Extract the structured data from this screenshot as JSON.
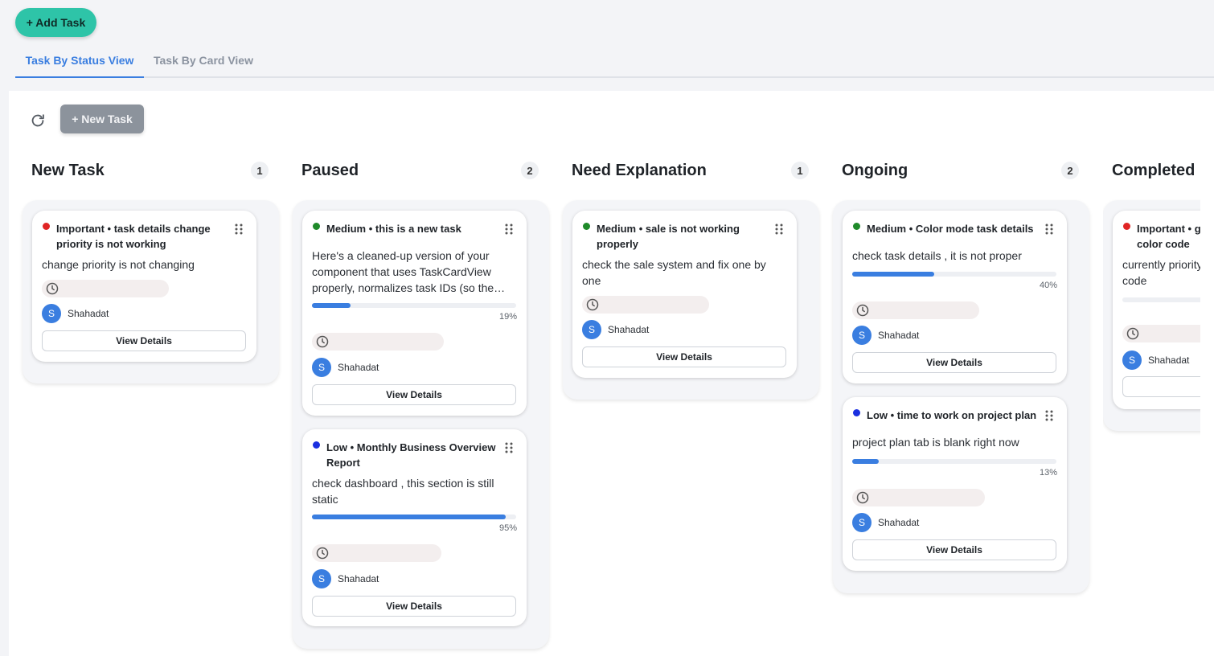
{
  "toolbar": {
    "add_task_label": "+ Add Task"
  },
  "tabs": [
    {
      "label": "Task By Status View",
      "active": true
    },
    {
      "label": "Task By Card View",
      "active": false
    }
  ],
  "panel": {
    "new_task_label": "+ New Task",
    "refresh_icon": "refresh-icon"
  },
  "columns": [
    {
      "title": "New Task",
      "count": "1",
      "cards": [
        {
          "priority": "Important",
          "priority_color": "#e02424",
          "title": "Important • task details change priority is not working",
          "description": "change priority is not changing",
          "assignee": "Shahadat",
          "assignee_initial": "S",
          "details_label": "View Details"
        }
      ]
    },
    {
      "title": "Paused",
      "count": "2",
      "cards": [
        {
          "priority": "Medium",
          "priority_color": "#1f8a2a",
          "title": "Medium • this is a new task",
          "description": "Here's a cleaned-up version of your component that uses TaskCardView properly, normalizes task IDs (so the…",
          "progress": 19,
          "progress_label": "19%",
          "assignee": "Shahadat",
          "assignee_initial": "S",
          "details_label": "View Details"
        },
        {
          "priority": "Low",
          "priority_color": "#1a2fe0",
          "title": "Low • Monthly Business Overview Report",
          "description": "check dashboard , this section is still static",
          "progress": 95,
          "progress_label": "95%",
          "assignee": "Shahadat",
          "assignee_initial": "S",
          "details_label": "View Details"
        }
      ]
    },
    {
      "title": "Need Explanation",
      "count": "1",
      "cards": [
        {
          "priority": "Medium",
          "priority_color": "#1f8a2a",
          "title": "Medium • sale is not working properly",
          "description": "check the sale system and fix one by one",
          "assignee": "Shahadat",
          "assignee_initial": "S",
          "details_label": "View Details"
        }
      ]
    },
    {
      "title": "Ongoing",
      "count": "2",
      "cards": [
        {
          "priority": "Medium",
          "priority_color": "#1f8a2a",
          "title": "Medium • Color mode task details",
          "description": "check task details , it is not proper",
          "progress": 40,
          "progress_label": "40%",
          "assignee": "Shahadat",
          "assignee_initial": "S",
          "details_label": "View Details"
        },
        {
          "priority": "Low",
          "priority_color": "#1a2fe0",
          "title": "Low • time to work on project plan",
          "description": "project plan tab is blank right now",
          "progress": 13,
          "progress_label": "13%",
          "assignee": "Shahadat",
          "assignee_initial": "S",
          "details_label": "View Details"
        }
      ]
    },
    {
      "title": "Completed",
      "cards": [
        {
          "priority": "Important",
          "priority_color": "#e02424",
          "title": "Important • gi color code",
          "description": "currently priority code",
          "assignee": "Shahadat",
          "assignee_initial": "S"
        }
      ]
    }
  ]
}
